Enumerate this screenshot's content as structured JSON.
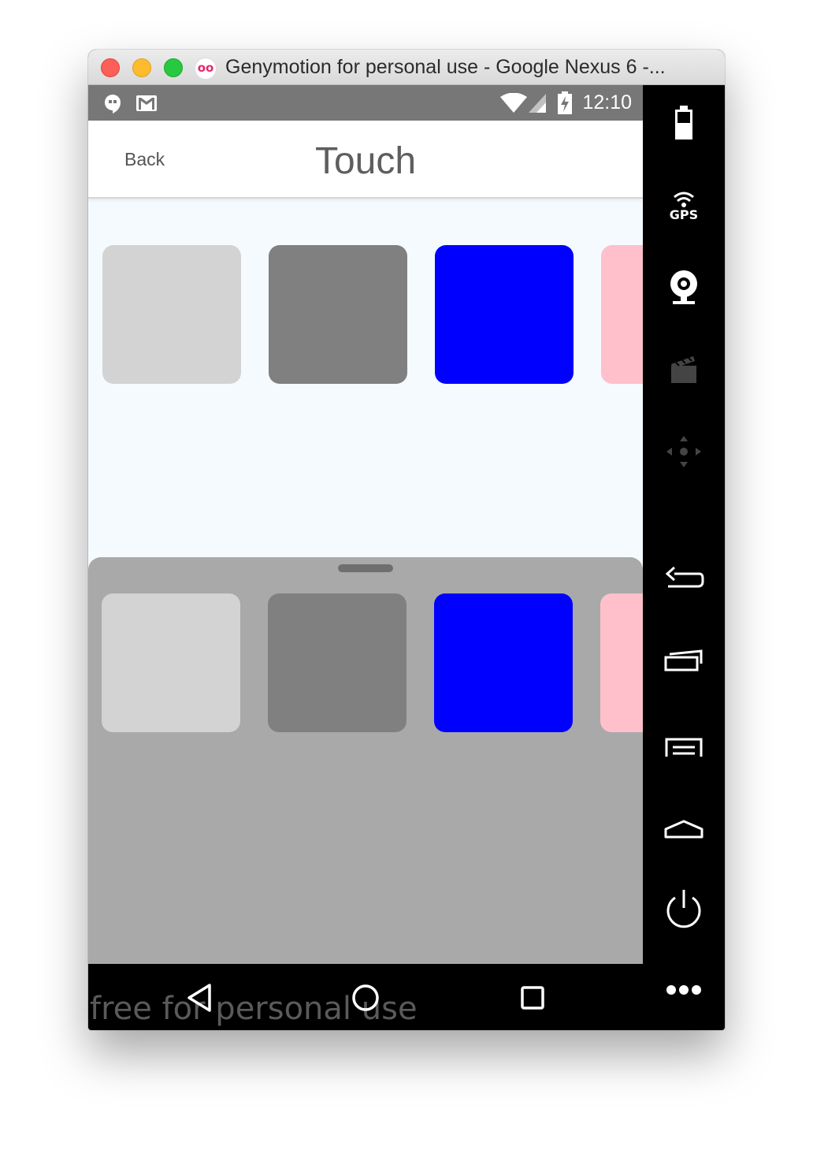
{
  "window": {
    "title": "Genymotion for personal use - Google Nexus 6 -..."
  },
  "statusbar": {
    "time": "12:10",
    "icons": [
      "hangouts-icon",
      "gmail-icon",
      "wifi-icon",
      "signal-icon",
      "battery-charging-icon"
    ]
  },
  "header": {
    "back_label": "Back",
    "title": "Touch"
  },
  "tiles": {
    "colors": [
      "#d3d3d3",
      "#808080",
      "#0000ff",
      "#ffc0cb"
    ]
  },
  "sheet": {
    "color": "#a9a9a9",
    "tile_colors": [
      "#d3d3d3",
      "#808080",
      "#0000ff",
      "#ffc0cb"
    ]
  },
  "navbar": {
    "watermark": "free for personal use"
  },
  "toolbar": {
    "gps_label": "GPS",
    "items": [
      "battery-icon",
      "gps-icon",
      "webcam-icon",
      "capture-icon",
      "dpad-icon",
      "back-icon",
      "recent-apps-icon",
      "menu-icon",
      "home-icon",
      "power-icon",
      "more-icon"
    ]
  }
}
